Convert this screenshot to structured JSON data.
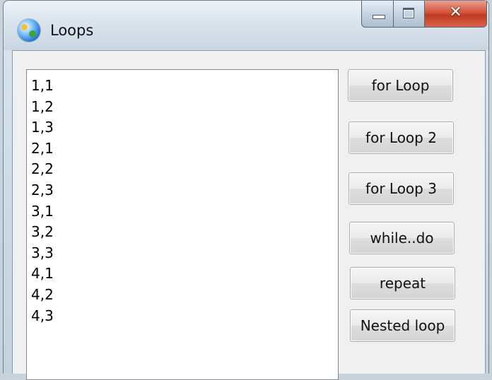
{
  "window": {
    "title": "Loops"
  },
  "list": {
    "items": [
      "1,1",
      "1,2",
      "1,3",
      "2,1",
      "2,2",
      "2,3",
      "3,1",
      "3,2",
      "3,3",
      "4,1",
      "4,2",
      "4,3"
    ]
  },
  "buttons": {
    "for_loop": "for Loop",
    "for_loop_2": "for Loop 2",
    "for_loop_3": "for Loop 3",
    "while_do": "while..do",
    "repeat": "repeat",
    "nested_loop": "Nested loop"
  },
  "caption": {
    "close_glyph": "✕"
  }
}
